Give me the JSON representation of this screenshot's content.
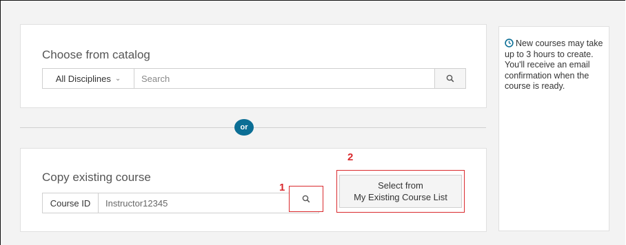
{
  "catalog": {
    "title": "Choose from catalog",
    "discipline_selected": "All Disciplines",
    "search_placeholder": "Search"
  },
  "divider": {
    "label": "or"
  },
  "copy": {
    "title": "Copy existing course",
    "course_id_label": "Course ID",
    "course_id_value": "Instructor12345",
    "select_button_line1": "Select from",
    "select_button_line2": "My Existing Course List"
  },
  "markers": {
    "one": "1",
    "two": "2"
  },
  "info": {
    "message": "New courses may take up to 3 hours to create. You'll receive an email confirmation when the course is ready."
  },
  "colors": {
    "accent": "#0b6e95",
    "highlight": "#d9282c"
  },
  "icons": {
    "search": "search-icon",
    "dropdown": "chevron-down-icon",
    "info": "clock-icon"
  }
}
